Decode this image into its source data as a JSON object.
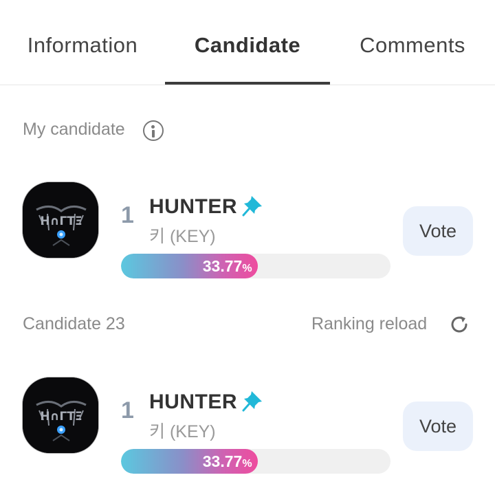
{
  "tabs": [
    {
      "label": "Information"
    },
    {
      "label": "Candidate",
      "active": true
    },
    {
      "label": "Comments"
    }
  ],
  "my_candidate": {
    "label": "My candidate",
    "icon": "info-circle-icon"
  },
  "candidates_header": {
    "label": "Candidate 23",
    "reload_label": "Ranking reload",
    "reload_icon": "refresh-icon"
  },
  "cards": [
    {
      "rank": "1",
      "name": "HUNTER",
      "subtitle": "키 (KEY)",
      "percent_text": "33.77",
      "percent_symbol": "%",
      "percent_value": 33.77,
      "vote_label": "Vote",
      "pin_icon": "pin-icon"
    },
    {
      "rank": "1",
      "name": "HUNTER",
      "subtitle": "키 (KEY)",
      "percent_text": "33.77",
      "percent_symbol": "%",
      "percent_value": 33.77,
      "vote_label": "Vote",
      "pin_icon": "pin-icon"
    }
  ],
  "colors": {
    "accent_pin": "#21b8d8",
    "progress_start": "#5bc8df",
    "progress_end": "#ee4c9e",
    "vote_bg": "#ebf1fb",
    "rank": "#8d9aaa"
  }
}
